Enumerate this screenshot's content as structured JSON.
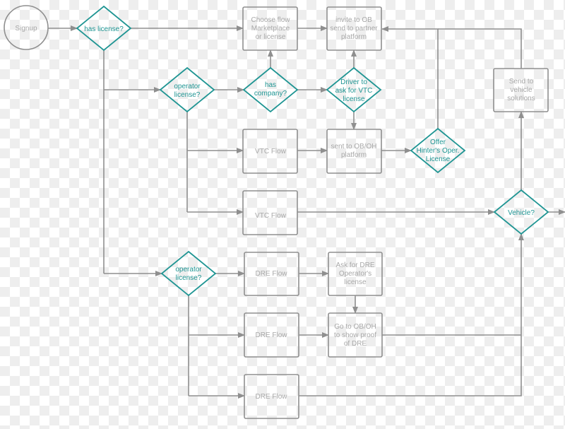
{
  "colors": {
    "decision": "#1f9593",
    "process": "#8f8f8f",
    "text_process": "#a8a8a8"
  },
  "nodes": {
    "signup": {
      "lines": [
        "Signup"
      ]
    },
    "has_license": {
      "lines": [
        "has license?"
      ]
    },
    "choose_flow": {
      "lines": [
        "Choose flow",
        "Marketplace",
        "or license"
      ]
    },
    "invite": {
      "lines": [
        "invite to OB",
        "send to partner",
        "platform"
      ]
    },
    "operator_license_1": {
      "lines": [
        "operator",
        "license?"
      ]
    },
    "has_company": {
      "lines": [
        "has",
        "company?"
      ]
    },
    "driver_vtc": {
      "lines": [
        "Driver to",
        "ask for VTC",
        "license"
      ]
    },
    "send_vehicle": {
      "lines": [
        "Send to",
        "vehicle",
        "solutions"
      ]
    },
    "vtc_flow_1": {
      "lines": [
        "VTC Flow"
      ]
    },
    "sent_obh": {
      "lines": [
        "sent to OB/OH",
        "platform"
      ]
    },
    "offer": {
      "lines": [
        "Offer",
        "Hinter's Oper.",
        "License"
      ]
    },
    "vtc_flow_2": {
      "lines": [
        "VTC Flow"
      ]
    },
    "vehicle": {
      "lines": [
        "Vehicle?"
      ]
    },
    "operator_license_2": {
      "lines": [
        "operator",
        "license?"
      ]
    },
    "dre_flow_1": {
      "lines": [
        "DRE Flow"
      ]
    },
    "ask_dre": {
      "lines": [
        "Ask for DRE",
        "Operator's",
        "license"
      ]
    },
    "dre_flow_2": {
      "lines": [
        "DRE Flow"
      ]
    },
    "go_obh": {
      "lines": [
        "Go to OB/OH",
        "to show proof",
        "of DRE"
      ]
    },
    "dre_flow_3": {
      "lines": [
        "DRE Flow"
      ]
    }
  }
}
